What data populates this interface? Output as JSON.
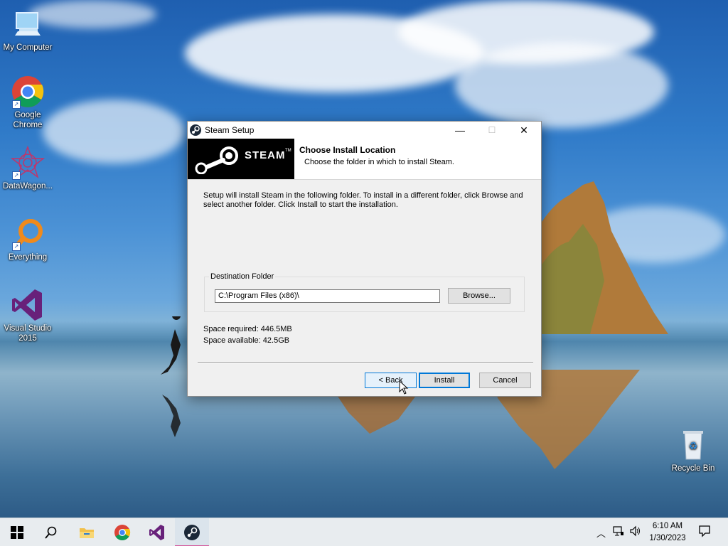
{
  "desktop": {
    "icons": [
      {
        "label": "My Computer",
        "icon": "computer-icon"
      },
      {
        "label": "Google Chrome",
        "icon": "chrome-icon"
      },
      {
        "label": "DataWagon...",
        "icon": "datawagon-icon"
      },
      {
        "label": "Everything",
        "icon": "everything-search-icon"
      },
      {
        "label": "Visual Studio 2015",
        "icon": "visual-studio-icon"
      },
      {
        "label": "Recycle Bin",
        "icon": "recycle-bin-icon"
      }
    ]
  },
  "dialog": {
    "window_title": "Steam Setup",
    "banner_text": "STEAM",
    "banner_tm": "TM",
    "header_title": "Choose Install Location",
    "header_subtitle": "Choose the folder in which to install Steam.",
    "intro_text": "Setup will install Steam in the following folder. To install in a different folder, click Browse and select another folder. Click Install to start the installation.",
    "destination_legend": "Destination Folder",
    "destination_path": "C:\\Program Files (x86)\\",
    "browse_label": "Browse...",
    "space_required": "Space required: 446.5MB",
    "space_available": "Space available: 42.5GB",
    "back_label": "< Back",
    "install_label": "Install",
    "cancel_label": "Cancel",
    "minimize_glyph": "—",
    "maximize_glyph": "☐",
    "close_glyph": "✕"
  },
  "taskbar": {
    "items": [
      {
        "icon": "windows-start-icon"
      },
      {
        "icon": "search-icon"
      },
      {
        "icon": "file-explorer-icon"
      },
      {
        "icon": "chrome-icon"
      },
      {
        "icon": "visual-studio-icon"
      },
      {
        "icon": "steam-icon",
        "active": true
      }
    ],
    "clock_time": "6:10 AM",
    "clock_date": "1/30/2023",
    "accent_color": "#d4569a"
  }
}
